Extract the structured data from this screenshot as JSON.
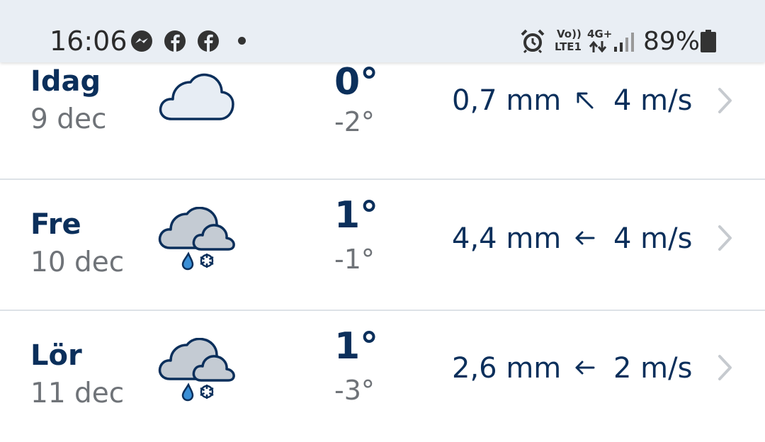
{
  "status_bar": {
    "time": "16:06",
    "notification_icons": [
      "messenger-icon",
      "facebook-icon",
      "facebook-icon",
      "more-notifications-dot"
    ],
    "alarm_icon": "alarm-icon",
    "volte_label": "Vo))",
    "lte_label": "LTE1",
    "network_label": "4G+",
    "signal_icon": "signal-icon",
    "battery_percent": "89%",
    "battery_icon": "battery-icon"
  },
  "forecast": [
    {
      "day": "Idag",
      "date": "9 dec",
      "icon": "cloud-icon",
      "max_temp": "0°",
      "min_temp": "-2°",
      "precipitation": "0,7 mm",
      "wind_direction_icon": "arrow-up-left-icon",
      "wind_speed": "4 m/s"
    },
    {
      "day": "Fre",
      "date": "10 dec",
      "icon": "sleet-icon",
      "max_temp": "1°",
      "min_temp": "-1°",
      "precipitation": "4,4 mm",
      "wind_direction_icon": "arrow-left-icon",
      "wind_speed": "4 m/s"
    },
    {
      "day": "Lör",
      "date": "11 dec",
      "icon": "sleet-icon",
      "max_temp": "1°",
      "min_temp": "-3°",
      "precipitation": "2,6 mm",
      "wind_direction_icon": "arrow-left-icon",
      "wind_speed": "2 m/s"
    }
  ],
  "colors": {
    "primary_text": "#0b2f5b",
    "secondary_text": "#6f7378",
    "status_bar_bg": "#e9eef4",
    "divider": "#dde2e7",
    "chevron": "#c6cacf"
  }
}
